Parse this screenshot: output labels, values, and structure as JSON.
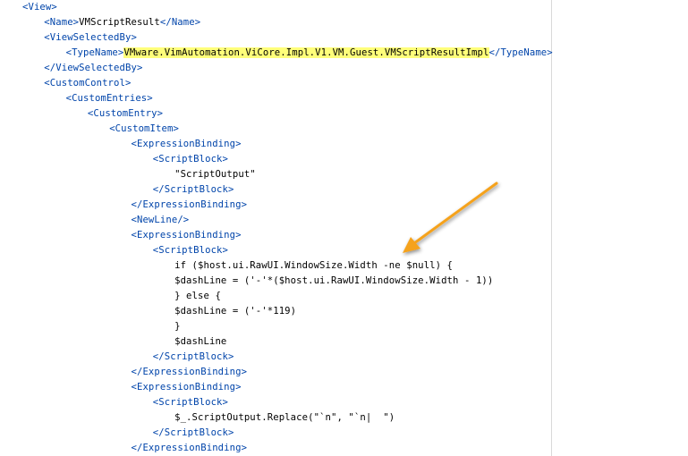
{
  "lines": [
    {
      "indent": 0,
      "parts": [
        {
          "k": "tag",
          "t": "<View>"
        }
      ]
    },
    {
      "indent": 1,
      "parts": [
        {
          "k": "tag",
          "t": "<Name>"
        },
        {
          "k": "txt",
          "t": "VMScriptResult"
        },
        {
          "k": "tag",
          "t": "</Name>"
        }
      ]
    },
    {
      "indent": 1,
      "parts": [
        {
          "k": "tag",
          "t": "<ViewSelectedBy>"
        }
      ]
    },
    {
      "indent": 2,
      "parts": [
        {
          "k": "tag",
          "t": "<TypeName>"
        },
        {
          "k": "hl",
          "t": "VMware.VimAutomation.ViCore.Impl.V1.VM.Guest.VMScriptResultImpl"
        },
        {
          "k": "tag",
          "t": "</TypeName>"
        }
      ]
    },
    {
      "indent": 1,
      "parts": [
        {
          "k": "tag",
          "t": "</ViewSelectedBy>"
        }
      ]
    },
    {
      "indent": 1,
      "parts": [
        {
          "k": "tag",
          "t": "<CustomControl>"
        }
      ]
    },
    {
      "indent": 2,
      "parts": [
        {
          "k": "tag",
          "t": "<CustomEntries>"
        }
      ]
    },
    {
      "indent": 3,
      "parts": [
        {
          "k": "tag",
          "t": "<CustomEntry>"
        }
      ]
    },
    {
      "indent": 4,
      "parts": [
        {
          "k": "tag",
          "t": "<CustomItem>"
        }
      ]
    },
    {
      "indent": 5,
      "parts": [
        {
          "k": "tag",
          "t": "<ExpressionBinding>"
        }
      ]
    },
    {
      "indent": 6,
      "parts": [
        {
          "k": "tag",
          "t": "<ScriptBlock>"
        }
      ]
    },
    {
      "indent": 7,
      "parts": [
        {
          "k": "txt",
          "t": "\"ScriptOutput\""
        }
      ]
    },
    {
      "indent": 6,
      "parts": [
        {
          "k": "tag",
          "t": "</ScriptBlock>"
        }
      ]
    },
    {
      "indent": 5,
      "parts": [
        {
          "k": "tag",
          "t": "</ExpressionBinding>"
        }
      ]
    },
    {
      "indent": 5,
      "parts": [
        {
          "k": "tag",
          "t": "<NewLine/>"
        }
      ]
    },
    {
      "indent": 5,
      "parts": [
        {
          "k": "tag",
          "t": "<ExpressionBinding>"
        }
      ]
    },
    {
      "indent": 6,
      "parts": [
        {
          "k": "tag",
          "t": "<ScriptBlock>"
        }
      ]
    },
    {
      "indent": 7,
      "parts": [
        {
          "k": "txt",
          "t": "if ($host.ui.RawUI.WindowSize.Width -ne $null) {"
        }
      ]
    },
    {
      "indent": 7,
      "parts": [
        {
          "k": "txt",
          "t": "$dashLine = ('-'*($host.ui.RawUI.WindowSize.Width - 1))"
        }
      ]
    },
    {
      "indent": 7,
      "parts": [
        {
          "k": "txt",
          "t": "} else {"
        }
      ]
    },
    {
      "indent": 7,
      "parts": [
        {
          "k": "txt",
          "t": "$dashLine = ('-'*119)"
        }
      ]
    },
    {
      "indent": 7,
      "parts": [
        {
          "k": "txt",
          "t": "}"
        }
      ]
    },
    {
      "indent": 7,
      "parts": [
        {
          "k": "txt",
          "t": "$dashLine"
        }
      ]
    },
    {
      "indent": 6,
      "parts": [
        {
          "k": "tag",
          "t": "</ScriptBlock>"
        }
      ]
    },
    {
      "indent": 5,
      "parts": [
        {
          "k": "tag",
          "t": "</ExpressionBinding>"
        }
      ]
    },
    {
      "indent": 5,
      "parts": [
        {
          "k": "tag",
          "t": "<ExpressionBinding>"
        }
      ]
    },
    {
      "indent": 6,
      "parts": [
        {
          "k": "tag",
          "t": "<ScriptBlock>"
        }
      ]
    },
    {
      "indent": 7,
      "parts": [
        {
          "k": "txt",
          "t": "$_.ScriptOutput.Replace(\"`n\", \"`n|  \")"
        }
      ]
    },
    {
      "indent": 6,
      "parts": [
        {
          "k": "tag",
          "t": "</ScriptBlock>"
        }
      ]
    },
    {
      "indent": 5,
      "parts": [
        {
          "k": "tag",
          "t": "</ExpressionBinding>"
        }
      ]
    }
  ],
  "colors": {
    "tag": "#0044aa",
    "text": "#000000",
    "highlight": "#ffff7a",
    "arrow": "#f5a21b"
  },
  "annotation": {
    "icon": "arrow-icon"
  }
}
